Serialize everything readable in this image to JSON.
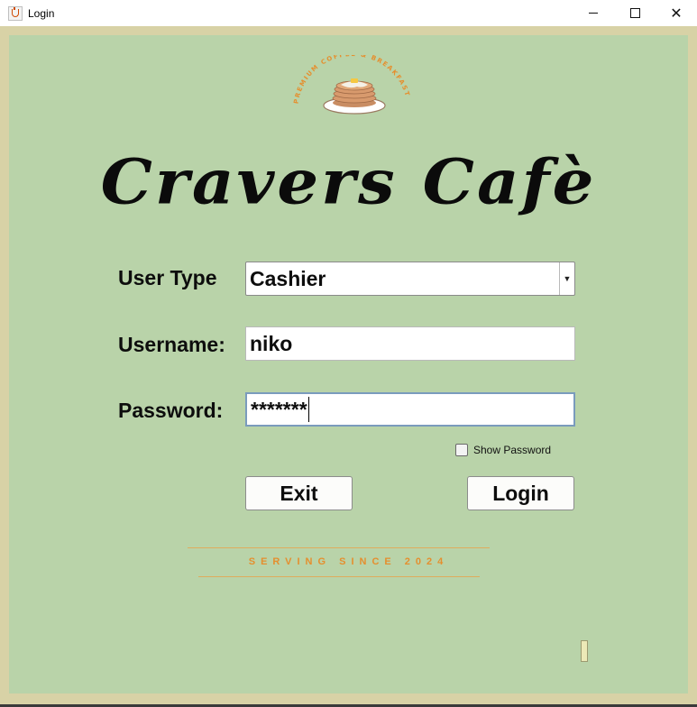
{
  "window": {
    "title": "Login",
    "controls": [
      "minimize-icon",
      "maximize-icon",
      "close-icon"
    ]
  },
  "logo": {
    "arc_text": "PREMIUM COFFEE & BREAKFAST",
    "icon": "pancake-stack-icon"
  },
  "brand": {
    "name": "Cravers Cafè"
  },
  "form": {
    "user_type_label": "User Type",
    "user_type_value": "Cashier",
    "username_label": "Username:",
    "username_value": "niko",
    "password_label": "Password:",
    "password_value": "*******",
    "show_password_label": "Show Password"
  },
  "buttons": {
    "exit": "Exit",
    "login": "Login"
  },
  "footer": {
    "tagline": "SERVING SINCE 2024"
  },
  "colors": {
    "panel_bg": "#b9d3a9",
    "frame_bg": "#d8d2a6",
    "accent_orange": "#e58f2e",
    "focus_border": "#7a9bbd"
  }
}
